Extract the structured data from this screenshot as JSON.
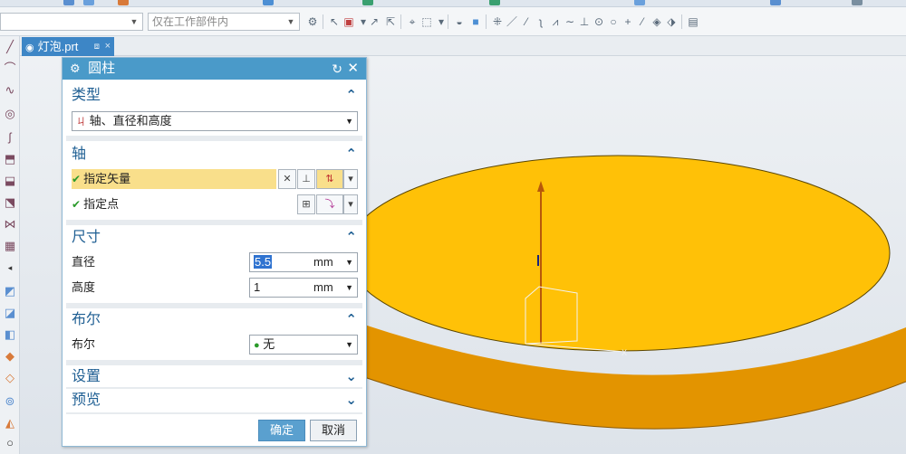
{
  "toolbar": {
    "filter_value": "",
    "scope_value": "仅在工作部件内"
  },
  "tab": {
    "title": "灯泡.prt"
  },
  "dialog": {
    "title": "圆柱",
    "sections": {
      "type": {
        "heading": "类型",
        "selected": "轴、直径和高度"
      },
      "axis": {
        "heading": "轴",
        "specify_vector": "指定矢量",
        "specify_point": "指定点"
      },
      "dimensions": {
        "heading": "尺寸",
        "diameter_label": "直径",
        "diameter_value": "5.5",
        "diameter_unit": "mm",
        "height_label": "高度",
        "height_value": "1",
        "height_unit": "mm"
      },
      "boolean": {
        "heading": "布尔",
        "label": "布尔",
        "value": "无"
      },
      "settings": {
        "heading": "设置"
      },
      "preview": {
        "heading": "预览"
      }
    },
    "ok_label": "确定",
    "cancel_label": "取消"
  },
  "colors": {
    "accent": "#4a9ac9",
    "tab": "#3d86c6",
    "highlight": "#f9df8b",
    "part_top": "#ffc107",
    "part_side": "#e39400"
  }
}
